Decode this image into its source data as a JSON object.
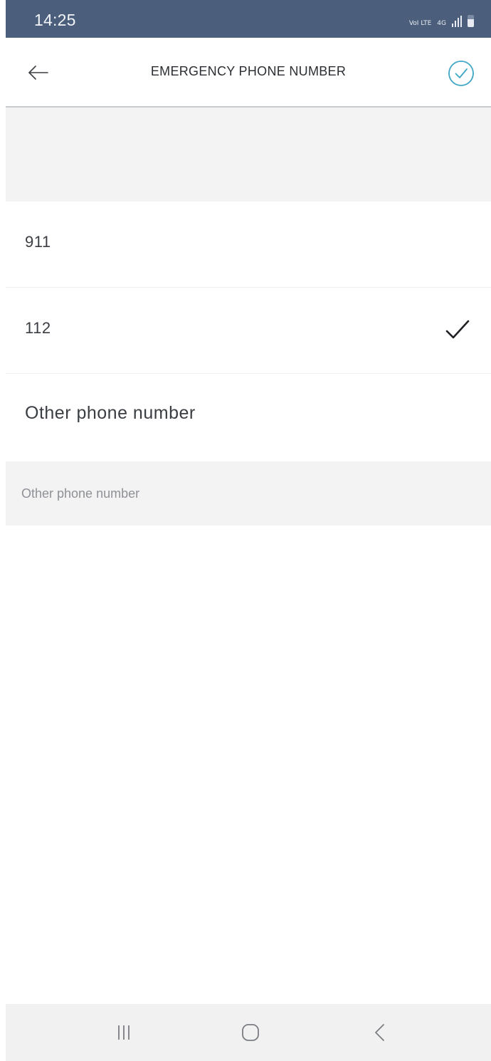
{
  "status_bar": {
    "time": "14:25",
    "network_label": "VoI LTE",
    "data_label": "4G",
    "colors": {
      "background": "#4b5f7c"
    }
  },
  "header": {
    "title": "EMERGENCY PHONE NUMBER",
    "back_icon": "arrow-left-icon",
    "confirm_icon": "circle-check-icon"
  },
  "options": [
    {
      "label": "911",
      "selected": false
    },
    {
      "label": "112",
      "selected": true
    },
    {
      "label": "Other phone number",
      "selected": false
    }
  ],
  "input": {
    "placeholder": "Other phone number",
    "value": ""
  },
  "nav_bar": {
    "recents_icon": "recents-icon",
    "home_icon": "home-icon",
    "back_icon": "back-chevron-icon"
  },
  "colors": {
    "accent": "#3fa7c4",
    "divider": "#c9cccf",
    "section_background": "#f3f3f3"
  }
}
